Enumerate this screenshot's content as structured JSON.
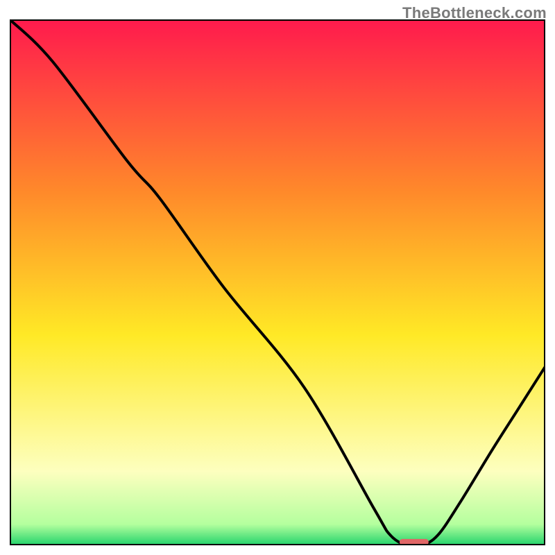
{
  "watermark": "TheBottleneck.com",
  "chart_data": {
    "type": "line",
    "title": "",
    "xlabel": "",
    "ylabel": "",
    "xlim": [
      0,
      100
    ],
    "ylim": [
      0,
      100
    ],
    "grid": false,
    "legend": false,
    "gradient_stops": [
      {
        "offset": 0,
        "color": "#ff1a4d"
      },
      {
        "offset": 0.33,
        "color": "#ff8a2a"
      },
      {
        "offset": 0.6,
        "color": "#ffe926"
      },
      {
        "offset": 0.86,
        "color": "#fdffbf"
      },
      {
        "offset": 0.96,
        "color": "#b4ff9e"
      },
      {
        "offset": 1.0,
        "color": "#22d36b"
      }
    ],
    "series": [
      {
        "name": "curve",
        "type": "line",
        "x": [
          0,
          8,
          22,
          28,
          40,
          55,
          68,
          71,
          74,
          77,
          80,
          84,
          90,
          95,
          100
        ],
        "y": [
          100,
          92,
          73,
          66,
          49,
          30,
          7,
          2,
          0,
          0,
          2,
          8,
          18,
          26,
          34
        ]
      }
    ],
    "marker": {
      "x": 75.5,
      "y": 0.6,
      "width": 5.4,
      "height": 1.2,
      "color": "#e06666",
      "rx": 4
    },
    "frame": {
      "stroke": "#000000",
      "width": 2
    }
  }
}
